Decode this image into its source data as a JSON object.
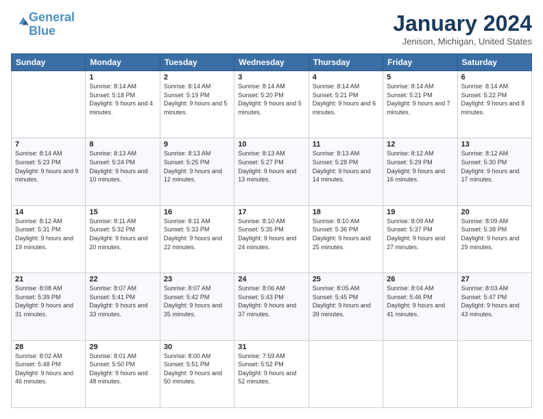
{
  "header": {
    "logo_line1": "General",
    "logo_line2": "Blue",
    "month_title": "January 2024",
    "location": "Jenison, Michigan, United States"
  },
  "days_of_week": [
    "Sunday",
    "Monday",
    "Tuesday",
    "Wednesday",
    "Thursday",
    "Friday",
    "Saturday"
  ],
  "weeks": [
    [
      {
        "day": "",
        "sunrise": "",
        "sunset": "",
        "daylight": ""
      },
      {
        "day": "1",
        "sunrise": "Sunrise: 8:14 AM",
        "sunset": "Sunset: 5:18 PM",
        "daylight": "Daylight: 9 hours and 4 minutes."
      },
      {
        "day": "2",
        "sunrise": "Sunrise: 8:14 AM",
        "sunset": "Sunset: 5:19 PM",
        "daylight": "Daylight: 9 hours and 5 minutes."
      },
      {
        "day": "3",
        "sunrise": "Sunrise: 8:14 AM",
        "sunset": "Sunset: 5:20 PM",
        "daylight": "Daylight: 9 hours and 5 minutes."
      },
      {
        "day": "4",
        "sunrise": "Sunrise: 8:14 AM",
        "sunset": "Sunset: 5:21 PM",
        "daylight": "Daylight: 9 hours and 6 minutes."
      },
      {
        "day": "5",
        "sunrise": "Sunrise: 8:14 AM",
        "sunset": "Sunset: 5:21 PM",
        "daylight": "Daylight: 9 hours and 7 minutes."
      },
      {
        "day": "6",
        "sunrise": "Sunrise: 8:14 AM",
        "sunset": "Sunset: 5:22 PM",
        "daylight": "Daylight: 9 hours and 8 minutes."
      }
    ],
    [
      {
        "day": "7",
        "sunrise": "Sunrise: 8:14 AM",
        "sunset": "Sunset: 5:23 PM",
        "daylight": "Daylight: 9 hours and 9 minutes."
      },
      {
        "day": "8",
        "sunrise": "Sunrise: 8:13 AM",
        "sunset": "Sunset: 5:24 PM",
        "daylight": "Daylight: 9 hours and 10 minutes."
      },
      {
        "day": "9",
        "sunrise": "Sunrise: 8:13 AM",
        "sunset": "Sunset: 5:25 PM",
        "daylight": "Daylight: 9 hours and 12 minutes."
      },
      {
        "day": "10",
        "sunrise": "Sunrise: 8:13 AM",
        "sunset": "Sunset: 5:27 PM",
        "daylight": "Daylight: 9 hours and 13 minutes."
      },
      {
        "day": "11",
        "sunrise": "Sunrise: 8:13 AM",
        "sunset": "Sunset: 5:28 PM",
        "daylight": "Daylight: 9 hours and 14 minutes."
      },
      {
        "day": "12",
        "sunrise": "Sunrise: 8:12 AM",
        "sunset": "Sunset: 5:29 PM",
        "daylight": "Daylight: 9 hours and 16 minutes."
      },
      {
        "day": "13",
        "sunrise": "Sunrise: 8:12 AM",
        "sunset": "Sunset: 5:30 PM",
        "daylight": "Daylight: 9 hours and 17 minutes."
      }
    ],
    [
      {
        "day": "14",
        "sunrise": "Sunrise: 8:12 AM",
        "sunset": "Sunset: 5:31 PM",
        "daylight": "Daylight: 9 hours and 19 minutes."
      },
      {
        "day": "15",
        "sunrise": "Sunrise: 8:11 AM",
        "sunset": "Sunset: 5:32 PM",
        "daylight": "Daylight: 9 hours and 20 minutes."
      },
      {
        "day": "16",
        "sunrise": "Sunrise: 8:11 AM",
        "sunset": "Sunset: 5:33 PM",
        "daylight": "Daylight: 9 hours and 22 minutes."
      },
      {
        "day": "17",
        "sunrise": "Sunrise: 8:10 AM",
        "sunset": "Sunset: 5:35 PM",
        "daylight": "Daylight: 9 hours and 24 minutes."
      },
      {
        "day": "18",
        "sunrise": "Sunrise: 8:10 AM",
        "sunset": "Sunset: 5:36 PM",
        "daylight": "Daylight: 9 hours and 25 minutes."
      },
      {
        "day": "19",
        "sunrise": "Sunrise: 8:09 AM",
        "sunset": "Sunset: 5:37 PM",
        "daylight": "Daylight: 9 hours and 27 minutes."
      },
      {
        "day": "20",
        "sunrise": "Sunrise: 8:09 AM",
        "sunset": "Sunset: 5:38 PM",
        "daylight": "Daylight: 9 hours and 29 minutes."
      }
    ],
    [
      {
        "day": "21",
        "sunrise": "Sunrise: 8:08 AM",
        "sunset": "Sunset: 5:39 PM",
        "daylight": "Daylight: 9 hours and 31 minutes."
      },
      {
        "day": "22",
        "sunrise": "Sunrise: 8:07 AM",
        "sunset": "Sunset: 5:41 PM",
        "daylight": "Daylight: 9 hours and 33 minutes."
      },
      {
        "day": "23",
        "sunrise": "Sunrise: 8:07 AM",
        "sunset": "Sunset: 5:42 PM",
        "daylight": "Daylight: 9 hours and 35 minutes."
      },
      {
        "day": "24",
        "sunrise": "Sunrise: 8:06 AM",
        "sunset": "Sunset: 5:43 PM",
        "daylight": "Daylight: 9 hours and 37 minutes."
      },
      {
        "day": "25",
        "sunrise": "Sunrise: 8:05 AM",
        "sunset": "Sunset: 5:45 PM",
        "daylight": "Daylight: 9 hours and 39 minutes."
      },
      {
        "day": "26",
        "sunrise": "Sunrise: 8:04 AM",
        "sunset": "Sunset: 5:46 PM",
        "daylight": "Daylight: 9 hours and 41 minutes."
      },
      {
        "day": "27",
        "sunrise": "Sunrise: 8:03 AM",
        "sunset": "Sunset: 5:47 PM",
        "daylight": "Daylight: 9 hours and 43 minutes."
      }
    ],
    [
      {
        "day": "28",
        "sunrise": "Sunrise: 8:02 AM",
        "sunset": "Sunset: 5:48 PM",
        "daylight": "Daylight: 9 hours and 46 minutes."
      },
      {
        "day": "29",
        "sunrise": "Sunrise: 8:01 AM",
        "sunset": "Sunset: 5:50 PM",
        "daylight": "Daylight: 9 hours and 48 minutes."
      },
      {
        "day": "30",
        "sunrise": "Sunrise: 8:00 AM",
        "sunset": "Sunset: 5:51 PM",
        "daylight": "Daylight: 9 hours and 50 minutes."
      },
      {
        "day": "31",
        "sunrise": "Sunrise: 7:59 AM",
        "sunset": "Sunset: 5:52 PM",
        "daylight": "Daylight: 9 hours and 52 minutes."
      },
      {
        "day": "",
        "sunrise": "",
        "sunset": "",
        "daylight": ""
      },
      {
        "day": "",
        "sunrise": "",
        "sunset": "",
        "daylight": ""
      },
      {
        "day": "",
        "sunrise": "",
        "sunset": "",
        "daylight": ""
      }
    ]
  ]
}
